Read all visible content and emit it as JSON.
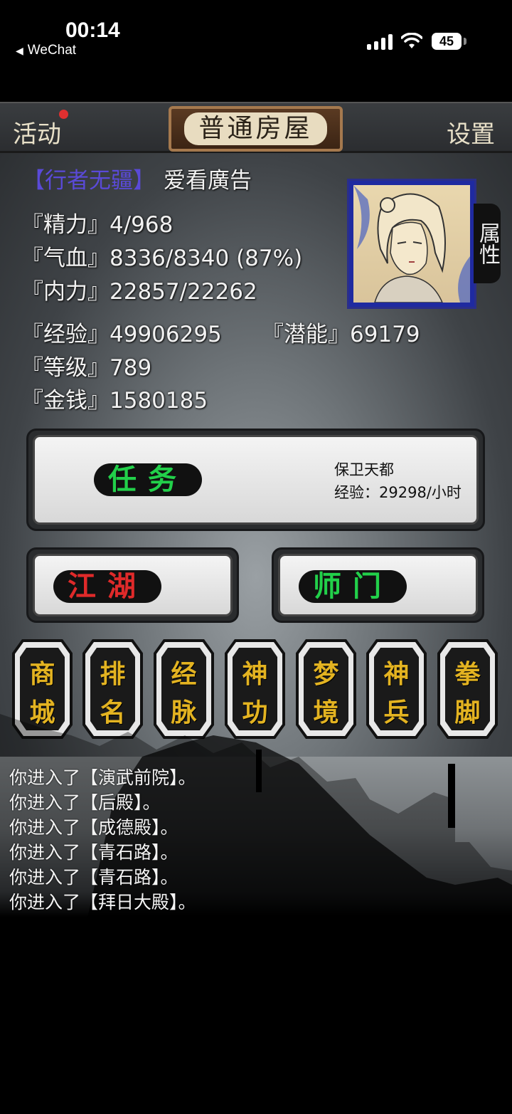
{
  "status_bar": {
    "time": "00:14",
    "back_label": "WeChat",
    "battery": "45"
  },
  "topbar": {
    "activity": "活动",
    "title": "普通房屋",
    "settings": "设置"
  },
  "player": {
    "guild": "【行者无疆】",
    "name": "爱看廣告",
    "attr_tab": "属性",
    "stats": {
      "energy": "『精力』4/968",
      "hp": "『气血』8336/8340 (87%)",
      "inner": "『内力』22857/22262",
      "exp": "『经验』49906295",
      "potential": "『潜能』69179",
      "level": "『等级』789",
      "money": "『金钱』1580185"
    }
  },
  "quest": {
    "label": "任务",
    "target": "保卫天都",
    "rate": "经验：29298/小时"
  },
  "buttons": {
    "jianghu": "江湖",
    "shimen": "师门"
  },
  "skills": [
    {
      "top": "商",
      "bottom": "城"
    },
    {
      "top": "排",
      "bottom": "名"
    },
    {
      "top": "经",
      "bottom": "脉"
    },
    {
      "top": "神",
      "bottom": "功"
    },
    {
      "top": "梦",
      "bottom": "境"
    },
    {
      "top": "神",
      "bottom": "兵"
    },
    {
      "top": "拳",
      "bottom": "脚"
    }
  ],
  "log": [
    "你进入了【演武前院】。",
    "你进入了【后殿】。",
    "你进入了【成德殿】。",
    "你进入了【青石路】。",
    "你进入了【青石路】。",
    "你进入了【拜日大殿】。"
  ],
  "colors": {
    "quest_text": "#22d04a",
    "jianghu_text": "#e02a2a",
    "shimen_text": "#22d04a",
    "skill_text": "#e3b321",
    "guild_text": "#5a4ad8"
  }
}
